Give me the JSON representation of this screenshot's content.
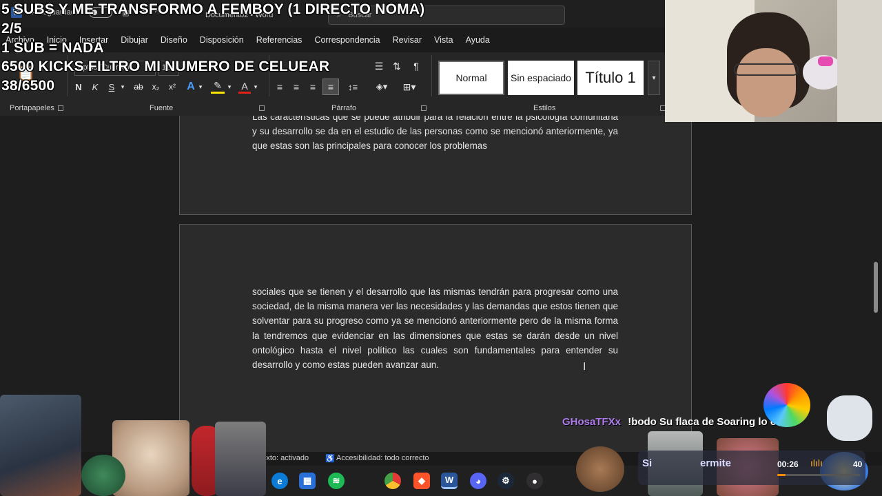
{
  "window": {
    "autosave_label": "Autoguardado",
    "doc_title": "Documento2 • Word",
    "search_placeholder": "Buscar"
  },
  "menu": [
    "Archivo",
    "Inicio",
    "Insertar",
    "Dibujar",
    "Diseño",
    "Disposición",
    "Referencias",
    "Correspondencia",
    "Revisar",
    "Vista",
    "Ayuda"
  ],
  "ribbon": {
    "groups": {
      "clipboard": "Portapapeles",
      "font": "Fuente",
      "paragraph": "Párrafo",
      "styles": "Estilos"
    },
    "font_name": "Aptos (Cuerpo)",
    "font_size": "11",
    "format_buttons": {
      "bold": "N",
      "italic": "K",
      "underline": "S",
      "strike": "ab",
      "subscript": "x₂",
      "superscript": "x²"
    },
    "styles": [
      "Normal",
      "Sin espaciado",
      "Título 1"
    ]
  },
  "document": {
    "page1_text": "Las características que se puede atribuir para la relación entre la psicología comunitaria y su desarrollo se da en el estudio de las personas como se mencionó anteriormente, ya que estas son las principales para conocer los problemas",
    "page2_text": "sociales que se tienen y el desarrollo que las mismas tendrán para progresar como una sociedad, de la misma manera ver las necesidades y las demandas que estos tienen que solventar para su progreso como ya se mencionó anteriormente pero de la misma forma la tendremos que evidenciar en las dimensiones que estas se darán desde un nivel ontológico hasta el nivel político las cuales son fundamentales para entender su desarrollo y como estas pueden avanzar aun."
  },
  "statusbar": {
    "text_prediction": "e texto: activado",
    "accessibility": "Accesibilidad: todo correcto"
  },
  "overlay": {
    "lines": [
      "5 SUBS Y ME TRANSFORMO A FEMBOY (1 DIRECTO NOMA)",
      "2/5",
      "1 SUB = NADA",
      "6500 KICKS FILTRO MI NUMERO DE CELUEAR",
      "38/6500"
    ],
    "chat_user": "GHosaTFXx",
    "chat_message": "!bodo Su flaca de Soaring lo     e",
    "user_color": "#b07cf0",
    "media_time": "00:26",
    "media_count": "40",
    "media_title": "Si",
    "media_extra": "ermite"
  },
  "taskbar_icons": [
    "edge-icon",
    "store-icon",
    "spotify-icon",
    "chrome-icon",
    "brave-icon",
    "word-icon",
    "discord-icon",
    "steam-icon",
    "obs-icon"
  ]
}
